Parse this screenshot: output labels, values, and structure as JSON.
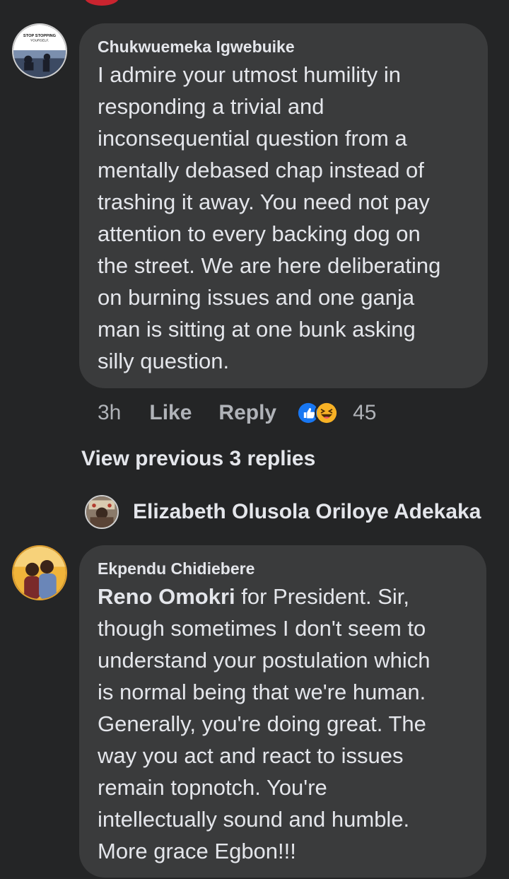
{
  "comments": [
    {
      "author": "Chukwuemeka Igwebuike",
      "avatar_label": "STOP STOPPING YOURSELF.",
      "text_lines": [
        " I admire your utmost humility in",
        "responding a trivial and",
        "inconsequential question from a",
        "mentally debased chap instead of",
        "trashing it away. You need not pay",
        "attention to every backing dog on",
        "the street. We are here deliberating",
        "on burning issues and one ganja",
        "man is sitting at one bunk asking",
        "silly question."
      ],
      "time": "3h",
      "like_label": "Like",
      "reply_label": "Reply",
      "reaction_icons": [
        "like-reaction-icon",
        "haha-reaction-icon"
      ],
      "reaction_count": "45"
    },
    {
      "author": "Ekpendu Chidiebere",
      "mention": "Reno Omokri",
      "first_line_rest": " for President. Sir,",
      "text_lines": [
        "though sometimes I don't seem to",
        "understand your postulation which",
        "is normal being that we're human.",
        "Generally, you're doing great. The",
        "way you act and react to issues",
        "remain topnotch. You're",
        "intellectually sound and humble.",
        "More grace Egbon!!!"
      ]
    }
  ],
  "view_previous_replies": "View previous 3 replies",
  "reply_preview": {
    "author": "Elizabeth Olusola Oriloye Adekaka"
  },
  "colors": {
    "background": "#242526",
    "bubble": "#3a3b3c",
    "text": "#e4e6eb",
    "secondary": "#b0b3b8",
    "like_blue": "#1877f2",
    "haha_yellow": "#f7b125"
  }
}
